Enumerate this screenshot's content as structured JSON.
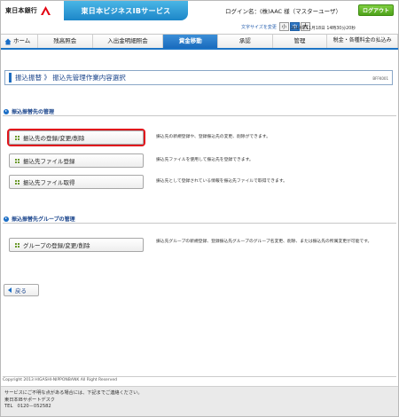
{
  "header": {
    "bank_name": "東日本銀行",
    "service_title": "東日本ビジネスIBサービス",
    "login_info": "ログイン名：(株)AAC 様（マスターユーザ）",
    "logout_label": "ログアウト",
    "font_size_label": "文字サイズを変更",
    "font_sizes": [
      "小",
      "中",
      "大"
    ],
    "timestamp": "2014年11月18日 14時30分20秒"
  },
  "nav": {
    "items": [
      "ホーム",
      "残高照会",
      "入出金明細照会",
      "資金移動",
      "承認",
      "管理",
      "税金・各種料金の払込み"
    ],
    "active": "資金移動"
  },
  "page": {
    "title": "振込振替 》 振込先管理作業内容選択",
    "screen_id": "BFFK001"
  },
  "sections": [
    {
      "title": "振込振替先の管理",
      "items": [
        {
          "label": "振込先の登録/変更/削除",
          "desc": "振込先の新規登録や、登録振込先の変更、削除ができます。"
        },
        {
          "label": "振込先ファイル登録",
          "desc": "振込先ファイルを使用して振込先を登録できます。"
        },
        {
          "label": "振込先ファイル取得",
          "desc": "振込先として登録されている情報を振込先ファイルで取得できます。"
        }
      ]
    },
    {
      "title": "振込振替先グループの管理",
      "items": [
        {
          "label": "グループの登録/変更/削除",
          "desc": "振込先グループの新規登録、登録振込先グループのグループ名変更、削除、または振込先の所属変更が可能です。"
        }
      ]
    }
  ],
  "back_label": "戻る",
  "copyright": "Copyright 2013 HIGASHI-NIPPONBANK All Right Reserved",
  "footer": {
    "line1": "サービスにご不明な点がある場合には、下記までご連絡ください。",
    "line2": "東日本IBサポートデスク",
    "line3": "TEL　0120－052582"
  },
  "colors": {
    "accent": "#1c74c6",
    "highlight": "#e0141c",
    "logout": "#5fb22a"
  }
}
